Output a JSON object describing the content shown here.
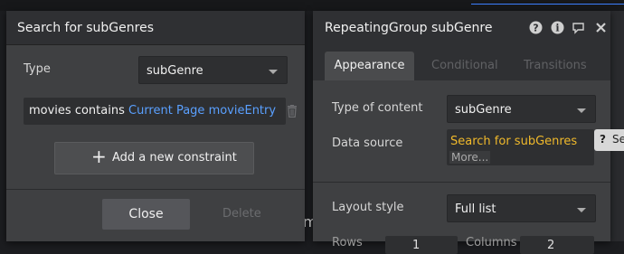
{
  "search_panel": {
    "title": "Search for subGenres",
    "type_label": "Type",
    "type_value": "subGenre",
    "constraint_field": "movies contains",
    "constraint_value": "Current Page movieEntry",
    "add_constraint_label": "Add a new constraint",
    "close_label": "Close",
    "delete_label": "Delete"
  },
  "rg_panel": {
    "title": "RepeatingGroup subGenre",
    "tabs": [
      "Appearance",
      "Conditional",
      "Transitions"
    ],
    "type_of_content_label": "Type of content",
    "type_of_content_value": "subGenre",
    "data_source_label": "Data source",
    "data_source_value": "Search for subGenres",
    "more_label": "More...",
    "layout_style_label": "Layout style",
    "layout_style_value": "Full list",
    "rows_label": "Rows",
    "rows_value": "1",
    "columns_label": "Columns",
    "columns_value": "2"
  },
  "help_tip": {
    "icon": "?",
    "text": "Se"
  },
  "background": {
    "letter": "m"
  },
  "colors": {
    "panel_bg": "#3f4042",
    "header_bg": "#2f3033",
    "dynamic_link": "#5aa0ff",
    "data_source_text": "#f0b92b"
  }
}
